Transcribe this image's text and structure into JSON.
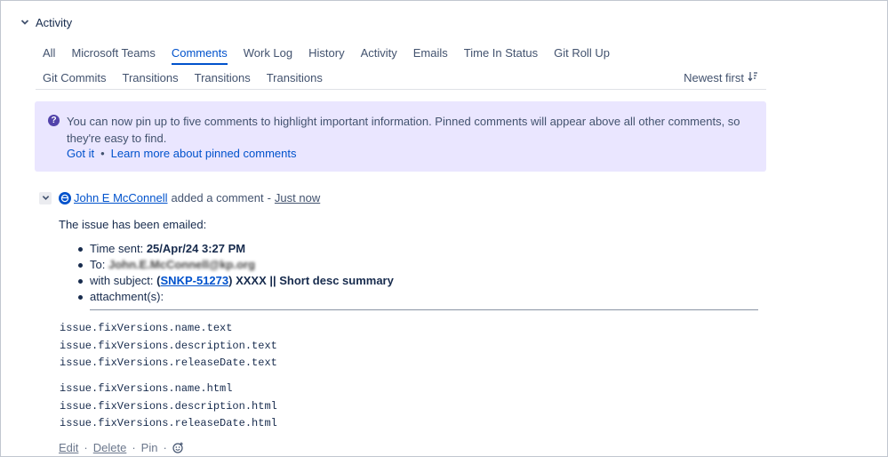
{
  "activity": {
    "title": "Activity"
  },
  "tabs_row1": [
    "All",
    "Microsoft Teams",
    "Comments",
    "Work Log",
    "History",
    "Activity",
    "Emails",
    "Time In Status",
    "Git Roll Up"
  ],
  "tabs_row2": [
    "Git Commits",
    "Transitions",
    "Transitions",
    "Transitions"
  ],
  "active_tab": "Comments",
  "sort": {
    "label": "Newest first"
  },
  "notice": {
    "text": "You can now pin up to five comments to highlight important information. Pinned comments will appear above all other comments, so they're easy to find.",
    "got_it": "Got it",
    "separator": "•",
    "learn_more": "Learn more about pinned comments"
  },
  "comment": {
    "author": "John E McConnell",
    "action": "added a comment",
    "separator": "-",
    "time": "Just now",
    "intro": "The issue has been emailed:",
    "time_sent_label": "Time sent:",
    "time_sent_value": "25/Apr/24 3:27 PM",
    "to_label": "To:",
    "to_value": "John.E.McConnell@kp.org",
    "subject_label": "with subject:",
    "subject_open": "(",
    "subject_ticket": "SNKP-51273",
    "subject_rest": ") XXXX || Short desc summary",
    "attachments_label": "attachment(s):",
    "code_block_1": [
      "issue.fixVersions.name.text",
      "issue.fixVersions.description.text",
      "issue.fixVersions.releaseDate.text"
    ],
    "code_block_2": [
      "issue.fixVersions.name.html",
      "issue.fixVersions.description.html",
      "issue.fixVersions.releaseDate.html"
    ]
  },
  "actions": {
    "edit": "Edit",
    "delete": "Delete",
    "pin": "Pin",
    "dot": "·"
  },
  "colors": {
    "accent": "#0052cc",
    "notice_bg": "#eae6ff",
    "notice_icon": "#5243aa"
  }
}
